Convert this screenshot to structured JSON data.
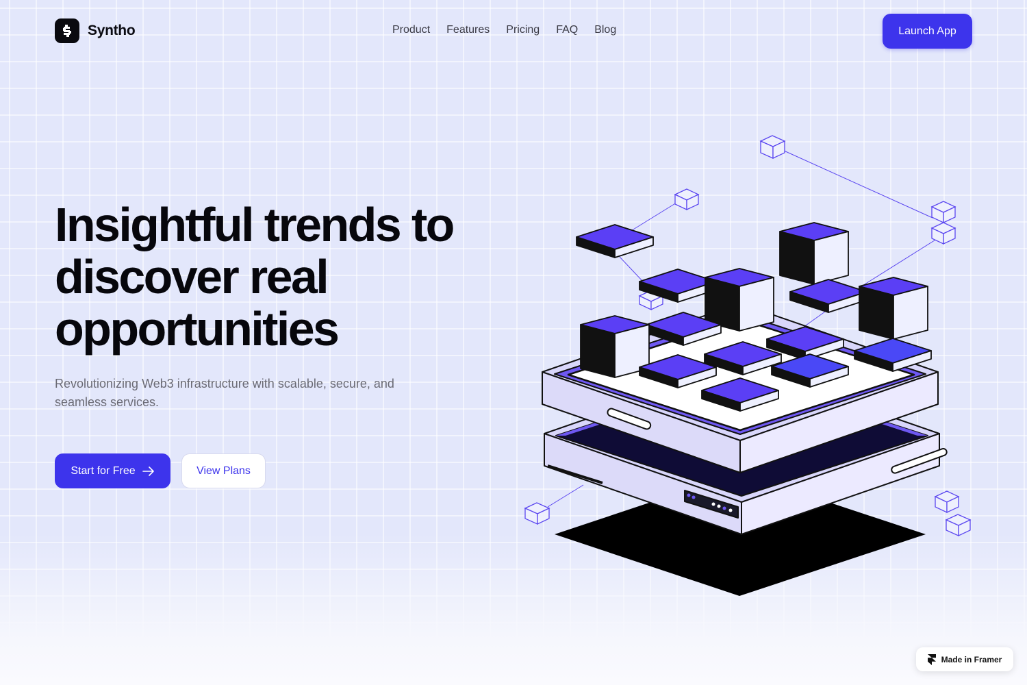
{
  "header": {
    "brand": "Syntho",
    "nav": [
      "Product",
      "Features",
      "Pricing",
      "FAQ",
      "Blog"
    ],
    "launch_label": "Launch App"
  },
  "hero": {
    "headline_lines": [
      "Insightful trends to",
      "discover real",
      "opportunities"
    ],
    "subtext": "Revolutionizing Web3 infrastructure with scalable, secure, and seamless services.",
    "primary_cta": "Start for Free",
    "secondary_cta": "View Plans"
  },
  "badge": {
    "label": "Made in Framer"
  },
  "colors": {
    "accent": "#3d34ec",
    "background": "#e3e7fb",
    "block_purple": "#5b3ff5",
    "server_lavender": "#d9d7fb"
  },
  "icons": {
    "logo": "logo-mark-icon",
    "arrow": "arrow-right-icon",
    "framer": "framer-logo-icon"
  }
}
